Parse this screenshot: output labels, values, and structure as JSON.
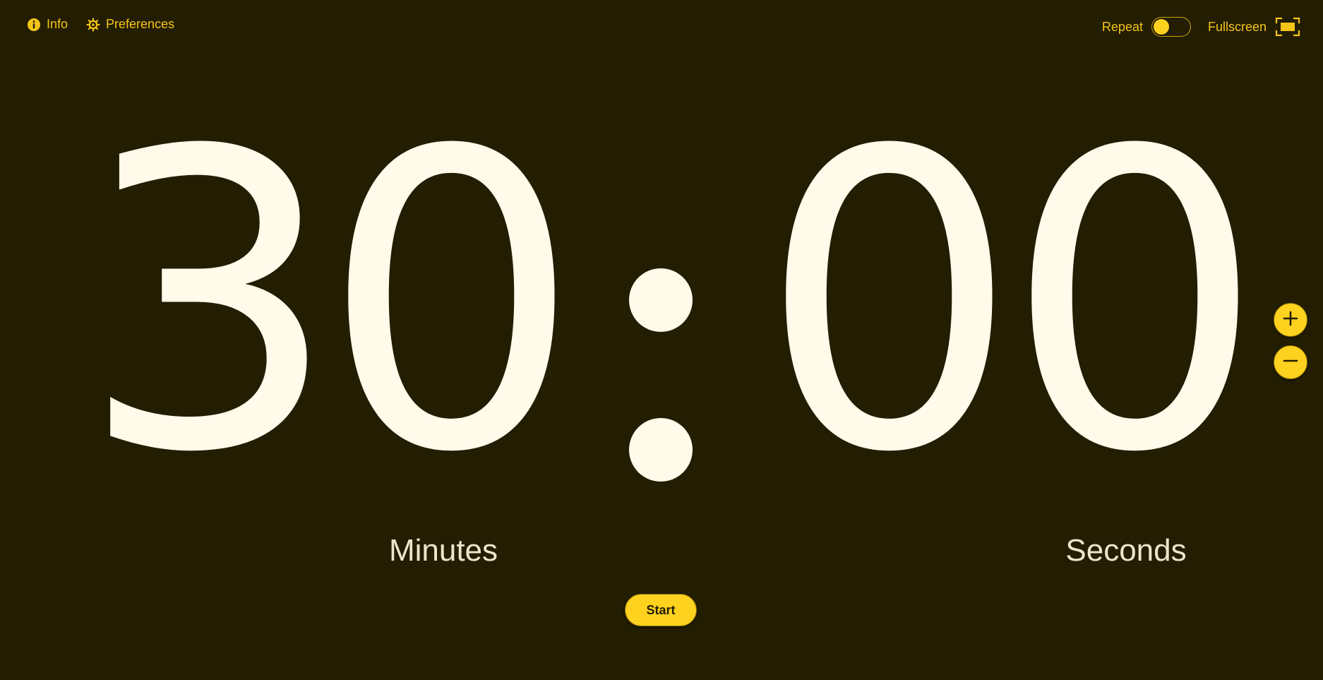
{
  "header": {
    "info_label": "Info",
    "info_icon": "info-circle-icon",
    "preferences_label": "Preferences",
    "preferences_icon": "gear-icon",
    "repeat_label": "Repeat",
    "repeat_enabled": false,
    "fullscreen_label": "Fullscreen",
    "fullscreen_icon": "fullscreen-icon"
  },
  "timer": {
    "minutes_tens": "3",
    "minutes_ones": "0",
    "seconds_tens": "0",
    "seconds_ones": "0",
    "minutes_label": "Minutes",
    "seconds_label": "Seconds"
  },
  "controls": {
    "increase_icon": "plus-icon",
    "decrease_icon": "minus-icon",
    "start_label": "Start"
  },
  "colors": {
    "background": "#231d02",
    "accent": "#ffd21f",
    "digit": "#fffaea",
    "label": "#ede4c9"
  }
}
